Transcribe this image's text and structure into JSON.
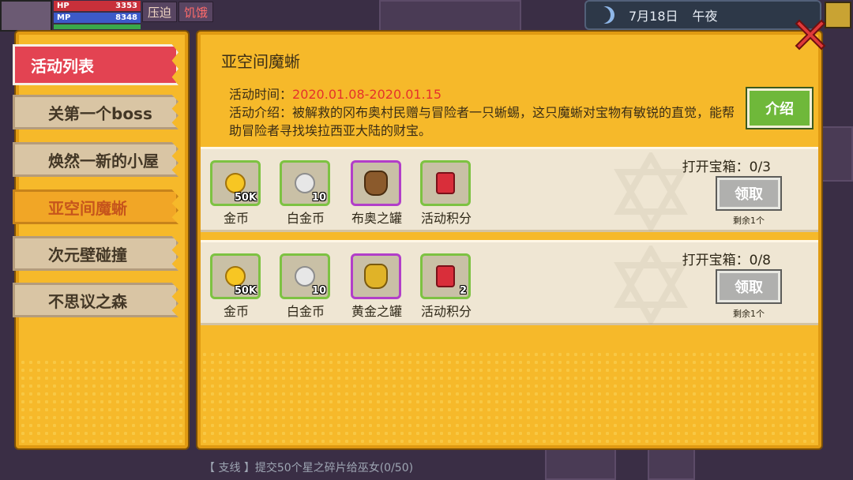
{
  "hud": {
    "hp_label": "HP",
    "hp_value": "3353",
    "mp_label": "MP",
    "mp_value": "8348",
    "status_1": "压迫",
    "status_2": "饥饿",
    "date": "7月18日",
    "time_of_day": "午夜"
  },
  "list": {
    "header": "活动列表",
    "items": [
      {
        "label": "关第一个boss"
      },
      {
        "label": "焕然一新的小屋"
      },
      {
        "label": "亚空间魔蜥"
      },
      {
        "label": "次元壁碰撞"
      },
      {
        "label": "不思议之森"
      }
    ]
  },
  "main": {
    "title": "亚空间魔蜥",
    "time_label": "活动时间：",
    "time_value": "2020.01.08-2020.01.15",
    "intro_text": "活动介绍：被解救的冈布奥村民赠与冒险者一只蜥蜴，这只魔蜥对宝物有敏锐的直觉，能帮助冒险者寻找埃拉西亚大陆的财宝。",
    "intro_button": "介绍"
  },
  "rewards": [
    {
      "box_label": "打开宝箱：0/3",
      "claim_label": "领取",
      "remain": "剩余1个",
      "items": [
        {
          "name": "金币",
          "count": "50K",
          "icon": "gold-coin-icon"
        },
        {
          "name": "白金币",
          "count": "10",
          "icon": "platinum-coin-icon"
        },
        {
          "name": "布奥之罐",
          "count": "",
          "icon": "bronze-jar-icon"
        },
        {
          "name": "活动积分",
          "count": "",
          "icon": "event-points-icon"
        }
      ]
    },
    {
      "box_label": "打开宝箱：0/8",
      "claim_label": "领取",
      "remain": "剩余1个",
      "items": [
        {
          "name": "金币",
          "count": "50K",
          "icon": "gold-coin-icon"
        },
        {
          "name": "白金币",
          "count": "10",
          "icon": "platinum-coin-icon"
        },
        {
          "name": "黄金之罐",
          "count": "",
          "icon": "gold-jar-icon"
        },
        {
          "name": "活动积分",
          "count": "2",
          "icon": "event-points-icon"
        }
      ]
    }
  ],
  "quest_text": "【 支线 】提交50个星之碎片给巫女(0/50)",
  "colors": {
    "panel": "#f6b92a",
    "header_red": "#e34352",
    "accent_red": "#e5322b"
  }
}
